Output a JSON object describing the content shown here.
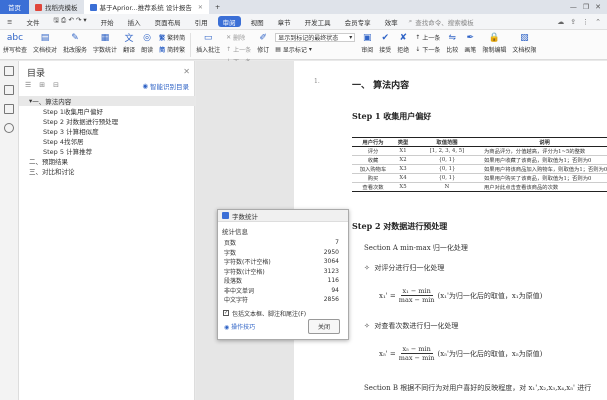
{
  "tabs": {
    "home": "首页",
    "template": "找稻壳模板",
    "doc": "基于Aprior...推荐系统 设计报告"
  },
  "menu": {
    "file": "文件",
    "items": [
      "开始",
      "插入",
      "页面布局",
      "引用",
      "审阅",
      "视图",
      "章节",
      "开发工具",
      "会员专享",
      "效率"
    ],
    "search_placeholder": "查找命令、搜索模板"
  },
  "toolbar": {
    "spell": "拼写检查",
    "proof": "文档校对",
    "batch": "批改服务",
    "count": "字数统计",
    "translate": "翻译",
    "read": "朗读",
    "tc_simp": "繁转简",
    "sc_trad": "简转繁",
    "insert_comment": "插入批注",
    "del": "删除",
    "prev": "上一条",
    "next": "下一条",
    "revise": "修订",
    "display_select": "显示到标记的最终状态",
    "show_markup": "显示标记",
    "review": "审阅",
    "accept": "接受",
    "reject": "拒绝",
    "prev2": "上一条",
    "next2": "下一条",
    "compare": "比较",
    "pen": "画笔",
    "limit_edit": "限制编辑",
    "doc_rights": "文档权限"
  },
  "toc": {
    "title": "目录",
    "smart": "智能识别目录",
    "items": [
      {
        "label": "一、算法内容",
        "level": 1,
        "selected": true
      },
      {
        "label": "Step 1收集用户偏好",
        "level": 2
      },
      {
        "label": "Step 2 对数据进行预处理",
        "level": 2
      },
      {
        "label": "Step 3 计算相似度",
        "level": 2
      },
      {
        "label": "Step 4找邻居",
        "level": 2
      },
      {
        "label": "Step 5 计算推荐",
        "level": 2
      },
      {
        "label": "二、预期结果",
        "level": 1
      },
      {
        "label": "三、对比和讨论",
        "level": 1
      }
    ]
  },
  "doc": {
    "h1": "一、   算法内容",
    "step1": "Step 1    收集用户偏好",
    "table": {
      "headers": [
        "用户行为",
        "类型",
        "取值范围",
        "说明"
      ],
      "rows": [
        [
          "评分",
          "X1",
          "[1, 2, 3, 4, 5]",
          "为商品评分，分值越高，评分为1~5的整数"
        ],
        [
          "收藏",
          "X2",
          "{0, 1}",
          "如果用户收藏了该商品，则取值为1；否则为0"
        ],
        [
          "加入购物车",
          "X3",
          "{0, 1}",
          "如果用户将该商品加入购物车，则取值为1；否则为0"
        ],
        [
          "购买",
          "X4",
          "{0, 1}",
          "如果用户购买了该商品，则取值为1；否则为0"
        ],
        [
          "查看次数",
          "X5",
          "N",
          "用户对此点击查看该商品的次数"
        ]
      ]
    },
    "step2": "Step 2    对数据进行预处理",
    "secA": "Section A  min-max 归一化处理",
    "bullet1": "对评分进行归一化处理",
    "formula1_lhs": "x₁' =",
    "formula1_num": "x₁ − min",
    "formula1_den": "max − min",
    "formula1_note": "(x₁'为归一化后的取值，x₁为原值)",
    "bullet2": "对查看次数进行归一化处理",
    "formula2_lhs": "x₅' =",
    "formula2_num": "x₅ − min",
    "formula2_den": "max − min",
    "formula2_note": "(x₅'为归一化后的取值，x₅为原值)",
    "secB": "Section B  根据不同行为对用户喜好的反映程度，对 x₁',x₂,x₃,x₄,x₅' 进行",
    "outline_marker": "1."
  },
  "dialog": {
    "title": "字数统计",
    "section": "统计信息",
    "rows": [
      {
        "label": "页数",
        "value": "7"
      },
      {
        "label": "字数",
        "value": "2950"
      },
      {
        "label": "字符数(不计空格)",
        "value": "3064"
      },
      {
        "label": "字符数(计空格)",
        "value": "3123"
      },
      {
        "label": "段落数",
        "value": "116"
      },
      {
        "label": "非中文单词",
        "value": "94"
      },
      {
        "label": "中文字符",
        "value": "2856"
      }
    ],
    "include": "包括文本框、脚注和尾注(F)",
    "tips": "操作技巧",
    "close": "关闭"
  },
  "colors": {
    "accent": "#3b6fd6",
    "dialog_link": "#2f63c6"
  }
}
